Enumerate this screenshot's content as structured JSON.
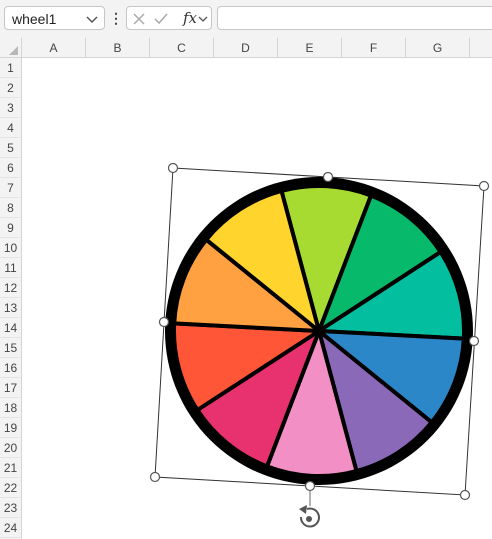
{
  "formula_bar": {
    "name_box_value": "wheel1",
    "name_box_arrow_icon": "chevron-down-icon",
    "more_icon": "vertical-dots-icon",
    "cancel_icon": "close-icon",
    "enter_icon": "check-icon",
    "fx_label": "fx",
    "fx_arrow_icon": "chevron-down-icon",
    "formula_value": ""
  },
  "sheet": {
    "columns": [
      "A",
      "B",
      "C",
      "D",
      "E",
      "F",
      "G"
    ],
    "rows": [
      "1",
      "2",
      "3",
      "4",
      "5",
      "6",
      "7",
      "8",
      "9",
      "10",
      "11",
      "12",
      "13",
      "14",
      "15",
      "16",
      "17",
      "18",
      "19",
      "20",
      "21",
      "22",
      "23",
      "24"
    ]
  },
  "shape": {
    "name": "wheel1",
    "rotate_icon": "rotate-icon",
    "rim_color": "#000000",
    "segment_colors": [
      "#A8DB32",
      "#07B96B",
      "#03BFA0",
      "#2C87C9",
      "#8A69B8",
      "#F28FC4",
      "#E8316F",
      "#FF5638",
      "#FFA041",
      "#FFD42C"
    ]
  }
}
